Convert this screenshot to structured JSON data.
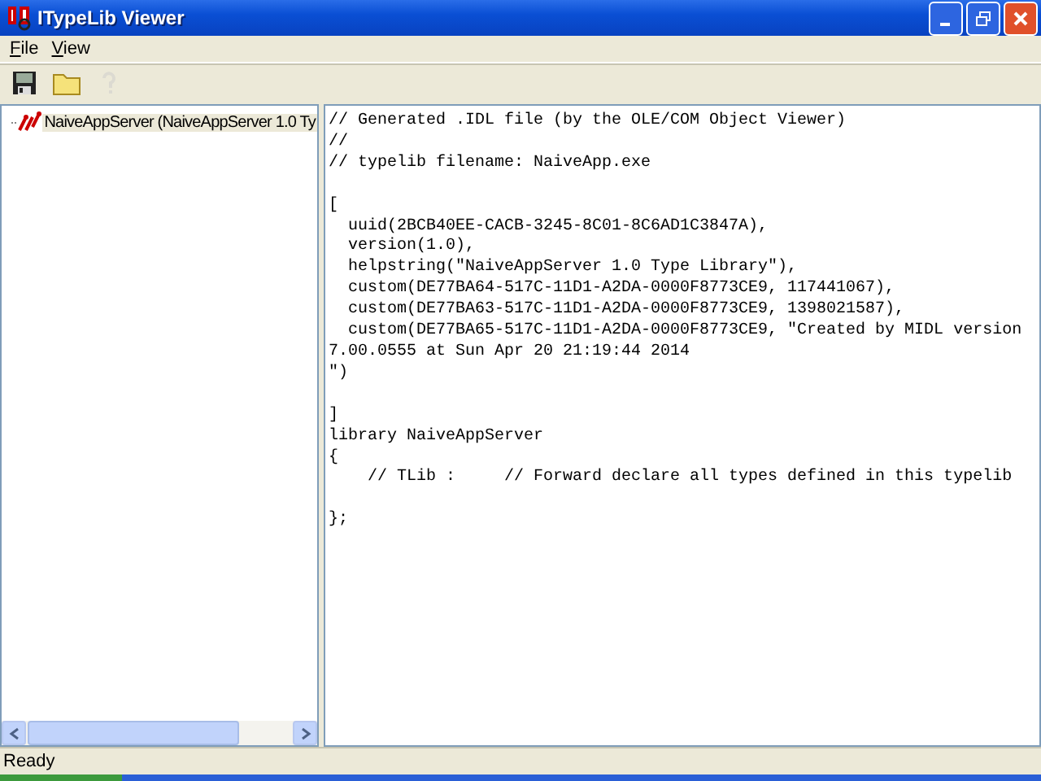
{
  "window": {
    "title": "ITypeLib Viewer"
  },
  "menu": [
    {
      "label": "File"
    },
    {
      "label": "View"
    }
  ],
  "toolbar": [
    {
      "kind": "save",
      "disabled": false
    },
    {
      "kind": "open",
      "disabled": false
    },
    {
      "kind": "help",
      "disabled": true
    }
  ],
  "tree": {
    "items": [
      {
        "label": "NaiveAppServer (NaiveAppServer 1.0 Ty",
        "selected": true
      }
    ]
  },
  "code": "// Generated .IDL file (by the OLE/COM Object Viewer)\n//\n// typelib filename: NaiveApp.exe\n\n[\n  uuid(2BCB40EE-CACB-3245-8C01-8C6AD1C3847A),\n  version(1.0),\n  helpstring(\"NaiveAppServer 1.0 Type Library\"),\n  custom(DE77BA64-517C-11D1-A2DA-0000F8773CE9, 117441067),\n  custom(DE77BA63-517C-11D1-A2DA-0000F8773CE9, 1398021587),\n  custom(DE77BA65-517C-11D1-A2DA-0000F8773CE9, \"Created by MIDL version\n7.00.0555 at Sun Apr 20 21:19:44 2014\n\")\n\n]\nlibrary NaiveAppServer\n{\n    // TLib :     // Forward declare all types defined in this typelib\n\n};",
  "status_bar": {
    "text": "Ready"
  }
}
